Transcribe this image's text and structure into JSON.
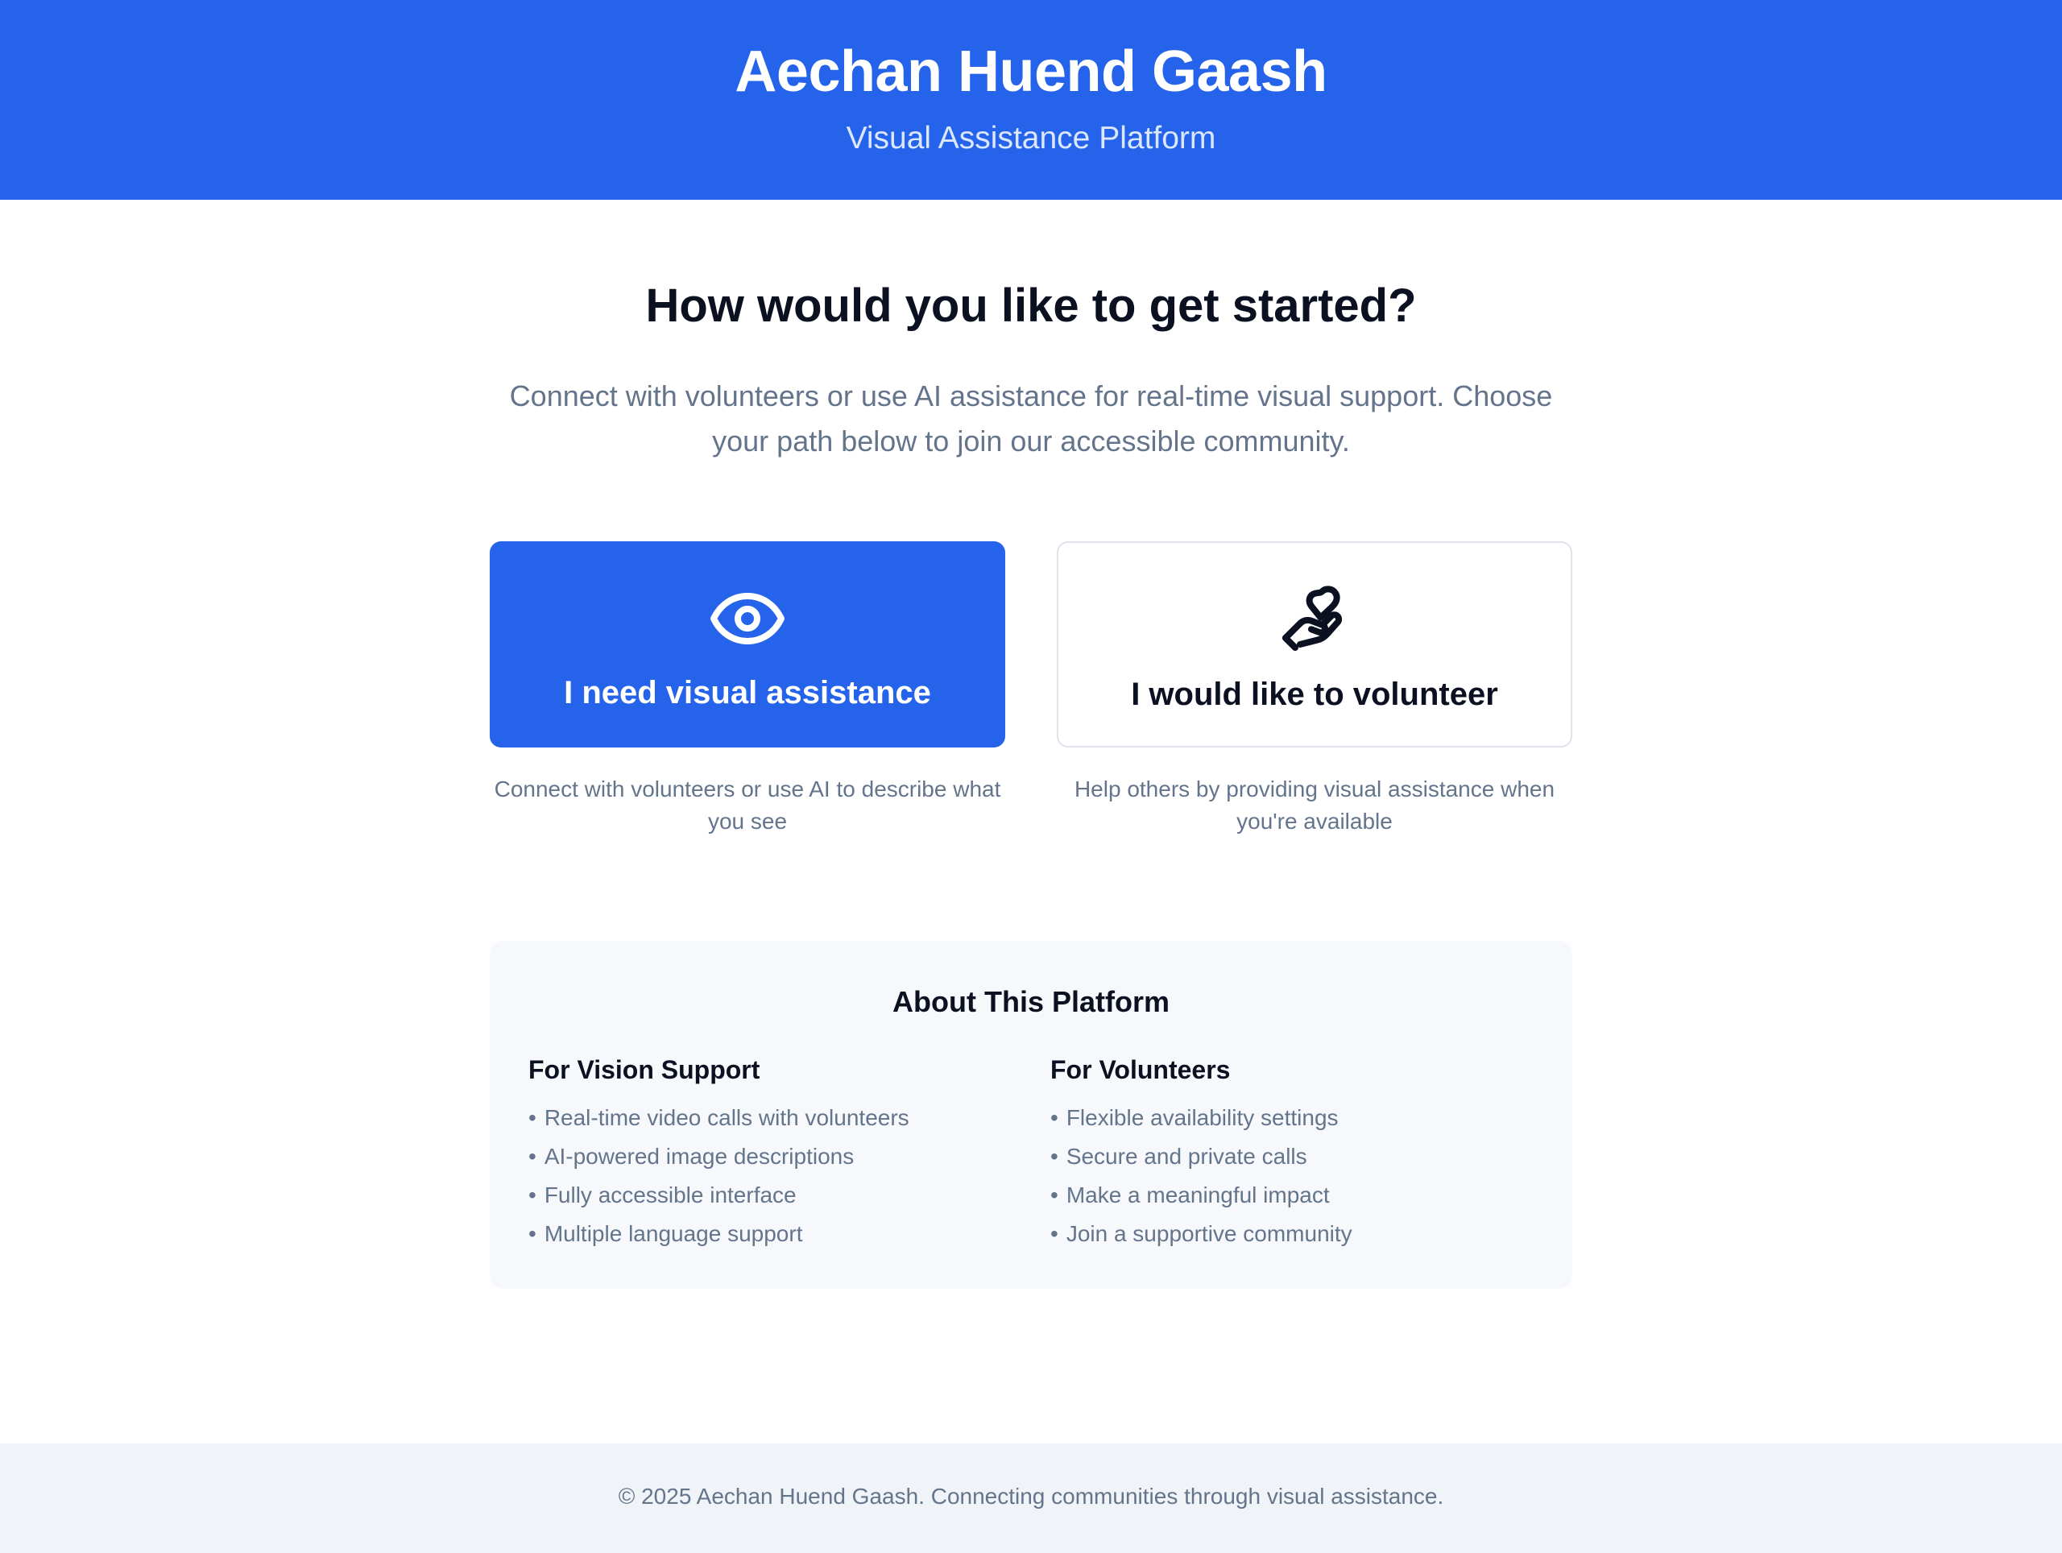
{
  "header": {
    "title": "Aechan Huend Gaash",
    "subtitle": "Visual Assistance Platform"
  },
  "intro": {
    "heading": "How would you like to get started?",
    "text": "Connect with volunteers or use AI assistance for real-time visual support. Choose your path below to join our accessible community."
  },
  "choices": {
    "assist": {
      "icon": "eye-icon",
      "title": "I need visual assistance",
      "description": "Connect with volunteers or use AI to describe what you see"
    },
    "volunteer": {
      "icon": "hand-heart-icon",
      "title": "I would like to volunteer",
      "description": "Help others by providing visual assistance when you're available"
    }
  },
  "about": {
    "title": "About This Platform",
    "vision": {
      "title": "For Vision Support",
      "items": [
        "Real-time video calls with volunteers",
        "AI-powered image descriptions",
        "Fully accessible interface",
        "Multiple language support"
      ]
    },
    "volunteers": {
      "title": "For Volunteers",
      "items": [
        "Flexible availability settings",
        "Secure and private calls",
        "Make a meaningful impact",
        "Join a supportive community"
      ]
    }
  },
  "footer": {
    "text": "© 2025 Aechan Huend Gaash. Connecting communities through visual assistance."
  },
  "colors": {
    "primary": "#2563eb",
    "muted_text": "#64748b",
    "panel_bg": "#f6f8fb",
    "footer_bg": "#f0f3f7"
  }
}
